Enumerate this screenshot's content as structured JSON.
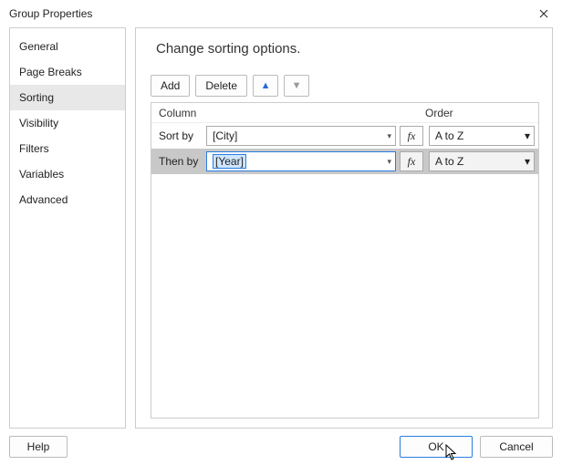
{
  "title": "Group Properties",
  "sidebar": {
    "items": [
      {
        "label": "General"
      },
      {
        "label": "Page Breaks"
      },
      {
        "label": "Sorting"
      },
      {
        "label": "Visibility"
      },
      {
        "label": "Filters"
      },
      {
        "label": "Variables"
      },
      {
        "label": "Advanced"
      }
    ],
    "selectedIndex": 2
  },
  "main": {
    "heading": "Change sorting options.",
    "toolbar": {
      "add": "Add",
      "delete": "Delete"
    },
    "columns": {
      "column": "Column",
      "order": "Order"
    },
    "rows": [
      {
        "label": "Sort by",
        "value": "[City]",
        "order": "A to Z",
        "fx": "fx"
      },
      {
        "label": "Then by",
        "value": "[Year]",
        "order": "A to Z",
        "fx": "fx"
      }
    ]
  },
  "footer": {
    "help": "Help",
    "ok": "OK",
    "cancel": "Cancel"
  }
}
